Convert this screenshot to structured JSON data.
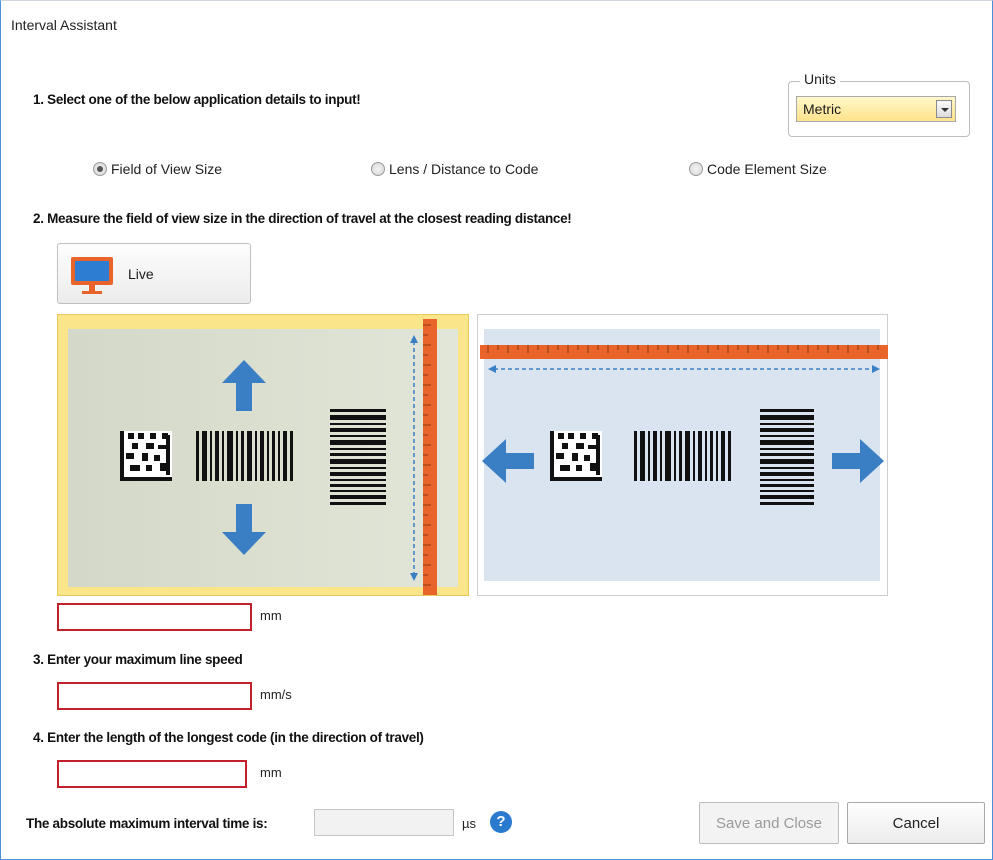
{
  "window": {
    "title": "Interval Assistant"
  },
  "step1": {
    "label": "1. Select one of the below application details to input!"
  },
  "units": {
    "legend": "Units",
    "selected": "Metric"
  },
  "options": [
    {
      "label": "Field of View Size",
      "checked": true
    },
    {
      "label": "Lens / Distance to Code",
      "checked": false
    },
    {
      "label": "Code Element Size",
      "checked": false
    }
  ],
  "step2": {
    "label": "2. Measure the field of view size in the direction of travel at the closest reading distance!"
  },
  "live_button": {
    "label": "Live"
  },
  "fov_field": {
    "value": "",
    "unit": "mm"
  },
  "step3": {
    "label": "3. Enter your maximum line speed"
  },
  "speed_field": {
    "value": "",
    "unit": "mm/s"
  },
  "step4": {
    "label": "4. Enter the length of the longest code (in the direction of travel)"
  },
  "code_length_field": {
    "value": "",
    "unit": "mm"
  },
  "result": {
    "label": "The absolute maximum interval time is:",
    "value": "",
    "unit": "µs",
    "help": "?"
  },
  "buttons": {
    "save": "Save and Close",
    "cancel": "Cancel"
  },
  "colors": {
    "selected_panel": "#fbe58a",
    "ruler": "#e8642a",
    "arrow": "#3a7fc4",
    "error_border": "#c0212b"
  }
}
